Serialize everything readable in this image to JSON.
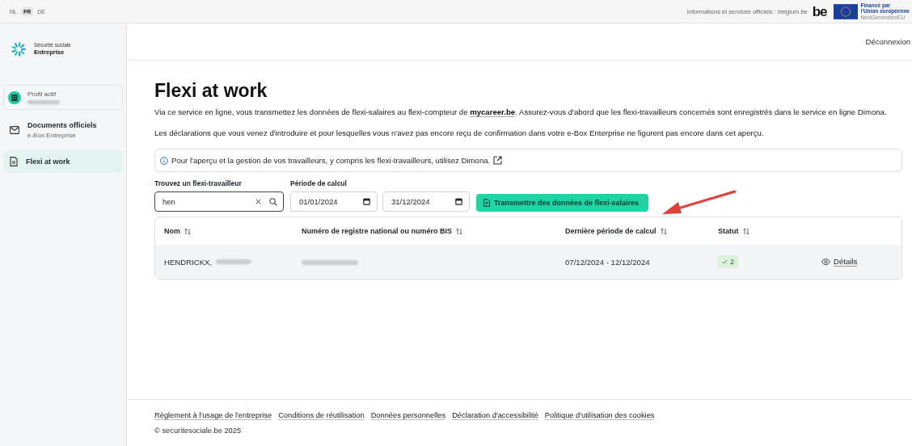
{
  "languages": [
    {
      "label": "NL",
      "selected": false
    },
    {
      "label": "FR",
      "selected": true
    },
    {
      "label": "DE",
      "selected": false
    }
  ],
  "official_link": "Informations et services officiels : belgium.be",
  "be_logo": "be",
  "eu_badge": {
    "line_1": "Financé par",
    "line_2": "l'Union européenne",
    "line_3": "NextGenerationEU"
  },
  "brand": {
    "line_1": "Sécurité sociale",
    "line_2": "Entreprise"
  },
  "sidebar": {
    "items": [
      {
        "kind": "profile",
        "title": "Profil actif",
        "selected": false
      },
      {
        "kind": "documents",
        "title": "Documents officiels",
        "subtitle": "e-Box Entreprise",
        "selected": false
      },
      {
        "kind": "page",
        "title": "Flexi at work",
        "selected": true
      }
    ]
  },
  "logout": "Déconnexion",
  "title": "Flexi at work",
  "intro": {
    "before": "Via ce service en ligne, vous transmettez les données de flexi-salaires au flexi-compteur de ",
    "link": "mycareer.be",
    "after": ". Assurez-vous d'abord que les flexi-travailleurs concernés sont enregistrés dans le service en ligne Dimona."
  },
  "note": "Les déclarations que vous venez d'introduire et pour lesquelles vous n'avez pas encore reçu de confirmation dans votre e-Box Enterprise ne figurent pas encore dans cet aperçu.",
  "notice": "Pour l'aperçu et la gestion de vos travailleurs, y compris les flexi-travailleurs, utilisez Dimona.",
  "search": {
    "label": "Trouvez un flexi-travailleur",
    "value": "hen"
  },
  "period": {
    "label": "Période de calcul",
    "from": "01/01/2024",
    "to": "31/12/2024"
  },
  "submit_button": "Transmettre des données de flexi-salaires",
  "table": {
    "columns": [
      "Nom",
      "Numéro de registre national ou numéro BIS",
      "Dernière période de calcul",
      "Statut"
    ],
    "rows": [
      {
        "name": "HENDRICKX,",
        "period": "07/12/2024 - 12/12/2024",
        "status": "2",
        "action": "Détails"
      }
    ]
  },
  "footer": {
    "links": [
      "Règlement à l'usage de l'entreprise",
      "Conditions de réutilisation",
      "Données personnelles",
      "Déclaration d'accessibilité",
      "Politique d'utilisation des cookies"
    ],
    "copyright": "© securitesociale.be 2025"
  }
}
